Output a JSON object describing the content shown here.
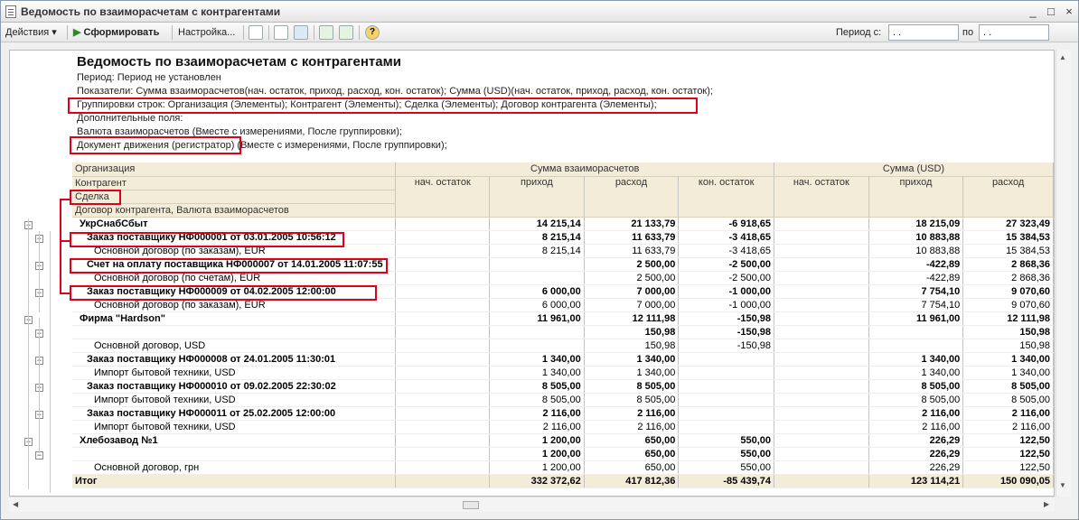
{
  "window": {
    "title": "Ведомость по взаиморасчетам с контрагентами",
    "minimize": "_",
    "maximize": "□",
    "close": "×"
  },
  "toolbar": {
    "actions": "Действия",
    "form": "Сформировать",
    "settings": "Настройка...",
    "period_from_label": "Период с:",
    "period_from_value": ". .",
    "period_to_label": "по",
    "period_to_value": ". ."
  },
  "report": {
    "title": "Ведомость по взаиморасчетам с контрагентами",
    "lines": [
      "Период: Период не установлен",
      "Показатели: Сумма взаиморасчетов(нач. остаток, приход, расход, кон. остаток); Сумма (USD)(нач. остаток, приход, расход, кон. остаток);",
      "Группировки строк: Организация (Элементы); Контрагент (Элементы); Сделка (Элементы); Договор контрагента (Элементы);",
      "Дополнительные поля:",
      "Валюта взаиморасчетов (Вместе с измерениями, После группировки);",
      "Документ движения (регистратор) (Вместе с измерениями, После группировки);"
    ],
    "headers": {
      "org": "Организация",
      "counterparty": "Контрагент",
      "deal": "Сделка",
      "contract": "Договор контрагента, Валюта взаиморасчетов",
      "group1": "Сумма взаиморасчетов",
      "group2": "Сумма (USD)",
      "cols1": [
        "нач. остаток",
        "приход",
        "расход",
        "кон. остаток"
      ],
      "cols2": [
        "нач. остаток",
        "приход",
        "расход"
      ]
    },
    "rows": [
      {
        "label": "УкрСнабСбыт",
        "v": [
          "",
          "14 215,14",
          "21 133,79",
          "-6 918,65",
          "",
          "18 215,09",
          "27 323,49"
        ]
      },
      {
        "label": "Заказ поставщику НФ000001 от 03.01.2005 10:56:12",
        "v": [
          "",
          "8 215,14",
          "11 633,79",
          "-3 418,65",
          "",
          "10 883,88",
          "15 384,53"
        ]
      },
      {
        "label": "Основной договор (по заказам), EUR",
        "v": [
          "",
          "8 215,14",
          "11 633,79",
          "-3 418,65",
          "",
          "10 883,88",
          "15 384,53"
        ]
      },
      {
        "label": "Счет на оплату поставщика НФ000007 от 14.01.2005 11:07:55",
        "v": [
          "",
          "",
          "2 500,00",
          "-2 500,00",
          "",
          "-422,89",
          "2 868,36"
        ]
      },
      {
        "label": "Основной договор (по счетам), EUR",
        "v": [
          "",
          "",
          "2 500,00",
          "-2 500,00",
          "",
          "-422,89",
          "2 868,36"
        ]
      },
      {
        "label": "Заказ поставщику НФ000009 от 04.02.2005 12:00:00",
        "v": [
          "",
          "6 000,00",
          "7 000,00",
          "-1 000,00",
          "",
          "7 754,10",
          "9 070,60"
        ]
      },
      {
        "label": "Основной договор (по заказам), EUR",
        "v": [
          "",
          "6 000,00",
          "7 000,00",
          "-1 000,00",
          "",
          "7 754,10",
          "9 070,60"
        ]
      },
      {
        "label": "Фирма \"Hardson\"",
        "v": [
          "",
          "11 961,00",
          "12 111,98",
          "-150,98",
          "",
          "11 961,00",
          "12 111,98"
        ]
      },
      {
        "label": "",
        "v": [
          "",
          "",
          "150,98",
          "-150,98",
          "",
          "",
          "150,98"
        ]
      },
      {
        "label": "Основной договор, USD",
        "v": [
          "",
          "",
          "150,98",
          "-150,98",
          "",
          "",
          "150,98"
        ]
      },
      {
        "label": "Заказ поставщику НФ000008 от 24.01.2005 11:30:01",
        "v": [
          "",
          "1 340,00",
          "1 340,00",
          "",
          "",
          "1 340,00",
          "1 340,00"
        ]
      },
      {
        "label": "Импорт бытовой техники, USD",
        "v": [
          "",
          "1 340,00",
          "1 340,00",
          "",
          "",
          "1 340,00",
          "1 340,00"
        ]
      },
      {
        "label": "Заказ поставщику НФ000010 от 09.02.2005 22:30:02",
        "v": [
          "",
          "8 505,00",
          "8 505,00",
          "",
          "",
          "8 505,00",
          "8 505,00"
        ]
      },
      {
        "label": "Импорт бытовой техники, USD",
        "v": [
          "",
          "8 505,00",
          "8 505,00",
          "",
          "",
          "8 505,00",
          "8 505,00"
        ]
      },
      {
        "label": "Заказ поставщику НФ000011 от 25.02.2005 12:00:00",
        "v": [
          "",
          "2 116,00",
          "2 116,00",
          "",
          "",
          "2 116,00",
          "2 116,00"
        ]
      },
      {
        "label": "Импорт бытовой техники, USD",
        "v": [
          "",
          "2 116,00",
          "2 116,00",
          "",
          "",
          "2 116,00",
          "2 116,00"
        ]
      },
      {
        "label": "Хлебозавод №1",
        "v": [
          "",
          "1 200,00",
          "650,00",
          "550,00",
          "",
          "226,29",
          "122,50"
        ]
      },
      {
        "label": "",
        "v": [
          "",
          "1 200,00",
          "650,00",
          "550,00",
          "",
          "226,29",
          "122,50"
        ]
      },
      {
        "label": "Основной договор, грн",
        "v": [
          "",
          "1 200,00",
          "650,00",
          "550,00",
          "",
          "226,29",
          "122,50"
        ]
      }
    ],
    "total": {
      "label": "Итог",
      "v": [
        "",
        "332 372,62",
        "417 812,36",
        "-85 439,74",
        "",
        "123 114,21",
        "150 090,05"
      ]
    }
  },
  "colors": {
    "highlight": "#e0001a",
    "header_bg": "#f3ecd8"
  }
}
